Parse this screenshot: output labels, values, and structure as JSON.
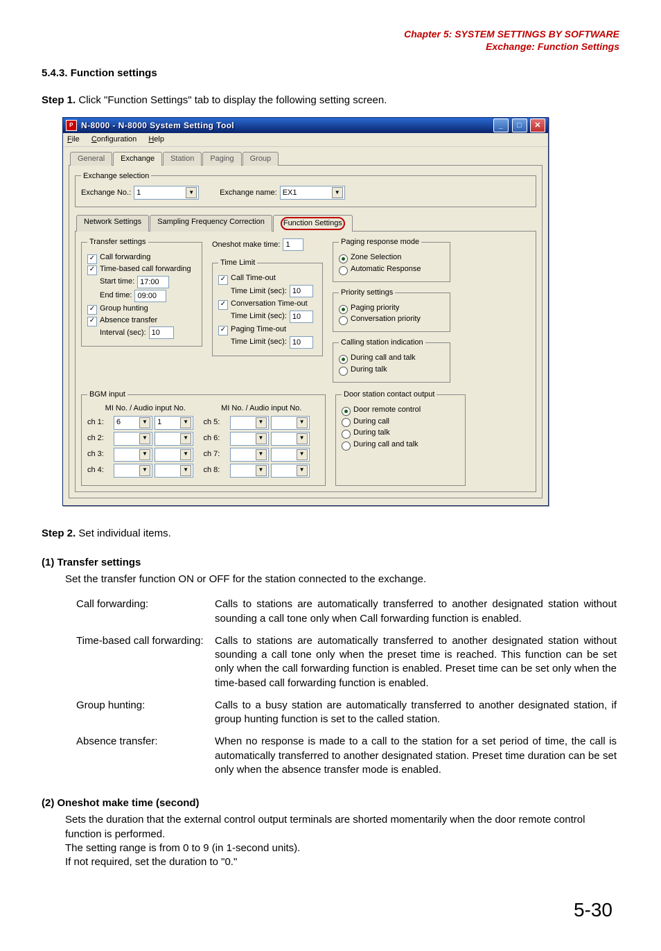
{
  "chapter": {
    "line1": "Chapter 5:  SYSTEM SETTINGS BY SOFTWARE",
    "line2": "Exchange: Function Settings"
  },
  "section_title": "5.4.3. Function settings",
  "step1": {
    "label": "Step 1.",
    "text": " Click \"Function Settings\" tab to display the following setting screen."
  },
  "window": {
    "title": "N-8000 - N-8000 System Setting Tool",
    "menu": {
      "file": "File",
      "file_u": "F",
      "config": "Configuration",
      "config_u": "C",
      "help": "Help",
      "help_u": "H"
    },
    "tabs": {
      "general": "General",
      "exchange": "Exchange",
      "station": "Station",
      "paging": "Paging",
      "group": "Group"
    },
    "exchange_selection": {
      "legend": "Exchange selection",
      "no_label": "Exchange No.:",
      "no_value": "1",
      "name_label": "Exchange name:",
      "name_value": "EX1"
    },
    "subtabs": {
      "net": "Network Settings",
      "samp": "Sampling Frequency Correction",
      "fn": "Function Settings"
    },
    "transfer": {
      "legend": "Transfer settings",
      "call_fwd": "Call forwarding",
      "time_based": "Time-based call forwarding",
      "start_label": "Start time:",
      "start_val": "17:00",
      "end_label": "End time:",
      "end_val": "09:00",
      "group_hunt": "Group hunting",
      "absence": "Absence transfer",
      "interval_label": "Interval (sec):",
      "interval_val": "10"
    },
    "oneshot": {
      "label": "Oneshot make time:",
      "val": "1"
    },
    "timelimit": {
      "legend": "Time Limit",
      "call_to": "Call Time-out",
      "call_to_val": "10",
      "conv_to": "Conversation Time-out",
      "conv_to_val": "10",
      "paging_to": "Paging Time-out",
      "paging_to_val": "10",
      "limit_label": "Time Limit (sec):"
    },
    "paging_resp": {
      "legend": "Paging response mode",
      "zone": "Zone Selection",
      "auto": "Automatic Response"
    },
    "priority": {
      "legend": "Priority settings",
      "paging": "Paging priority",
      "conv": "Conversation priority"
    },
    "calling_ind": {
      "legend": "Calling station indication",
      "call_talk": "During call and talk",
      "talk": "During talk"
    },
    "bgm": {
      "legend": "BGM input",
      "hdr1": "MI No. / Audio input No.",
      "hdr2": "MI No. / Audio input No.",
      "ch1": "ch 1:",
      "ch1_mi": "6",
      "ch1_ai": "1",
      "ch2": "ch 2:",
      "ch3": "ch 3:",
      "ch4": "ch 4:",
      "ch5": "ch 5:",
      "ch6": "ch 6:",
      "ch7": "ch 7:",
      "ch8": "ch 8:"
    },
    "door": {
      "legend": "Door station contact output",
      "remote": "Door remote control",
      "call": "During call",
      "talk": "During talk",
      "call_talk": "During call and talk"
    }
  },
  "step2": {
    "label": "Step 2.",
    "text": " Set individual items."
  },
  "transfer_section": {
    "title": "(1)  Transfer settings",
    "intro": "Set the transfer function ON or OFF for the station connected to the exchange.",
    "cf_label": "Call forwarding:",
    "cf_text": "Calls to stations are automatically transferred to another designated station without sounding a call tone only when Call forwarding function is enabled.",
    "tb_label": "Time-based call forwarding:",
    "tb_text": "Calls to stations are automatically transferred to another designated station without sounding a call tone only when the preset time is reached. This function can be set only when the call forwarding function is enabled. Preset time can be set only when the time-based call forwarding function is enabled.",
    "gh_label": "Group hunting:",
    "gh_text": "Calls to a busy station are automatically transferred to another designated station, if group hunting function is set to the called station.",
    "at_label": "Absence transfer:",
    "at_text": "When no response is made to a call to the station for a set period of time, the call is automatically transferred to another designated station. Preset time duration can be set only when the absence transfer mode is enabled."
  },
  "oneshot_section": {
    "title": "(2)  Oneshot make time (second)",
    "l1": "Sets the duration that the external control output terminals are shorted momentarily when the door remote control function is performed.",
    "l2": "The setting range is from 0 to 9 (in 1-second units).",
    "l3": "If not required, set the duration to \"0.\""
  },
  "page_number": "5-30"
}
